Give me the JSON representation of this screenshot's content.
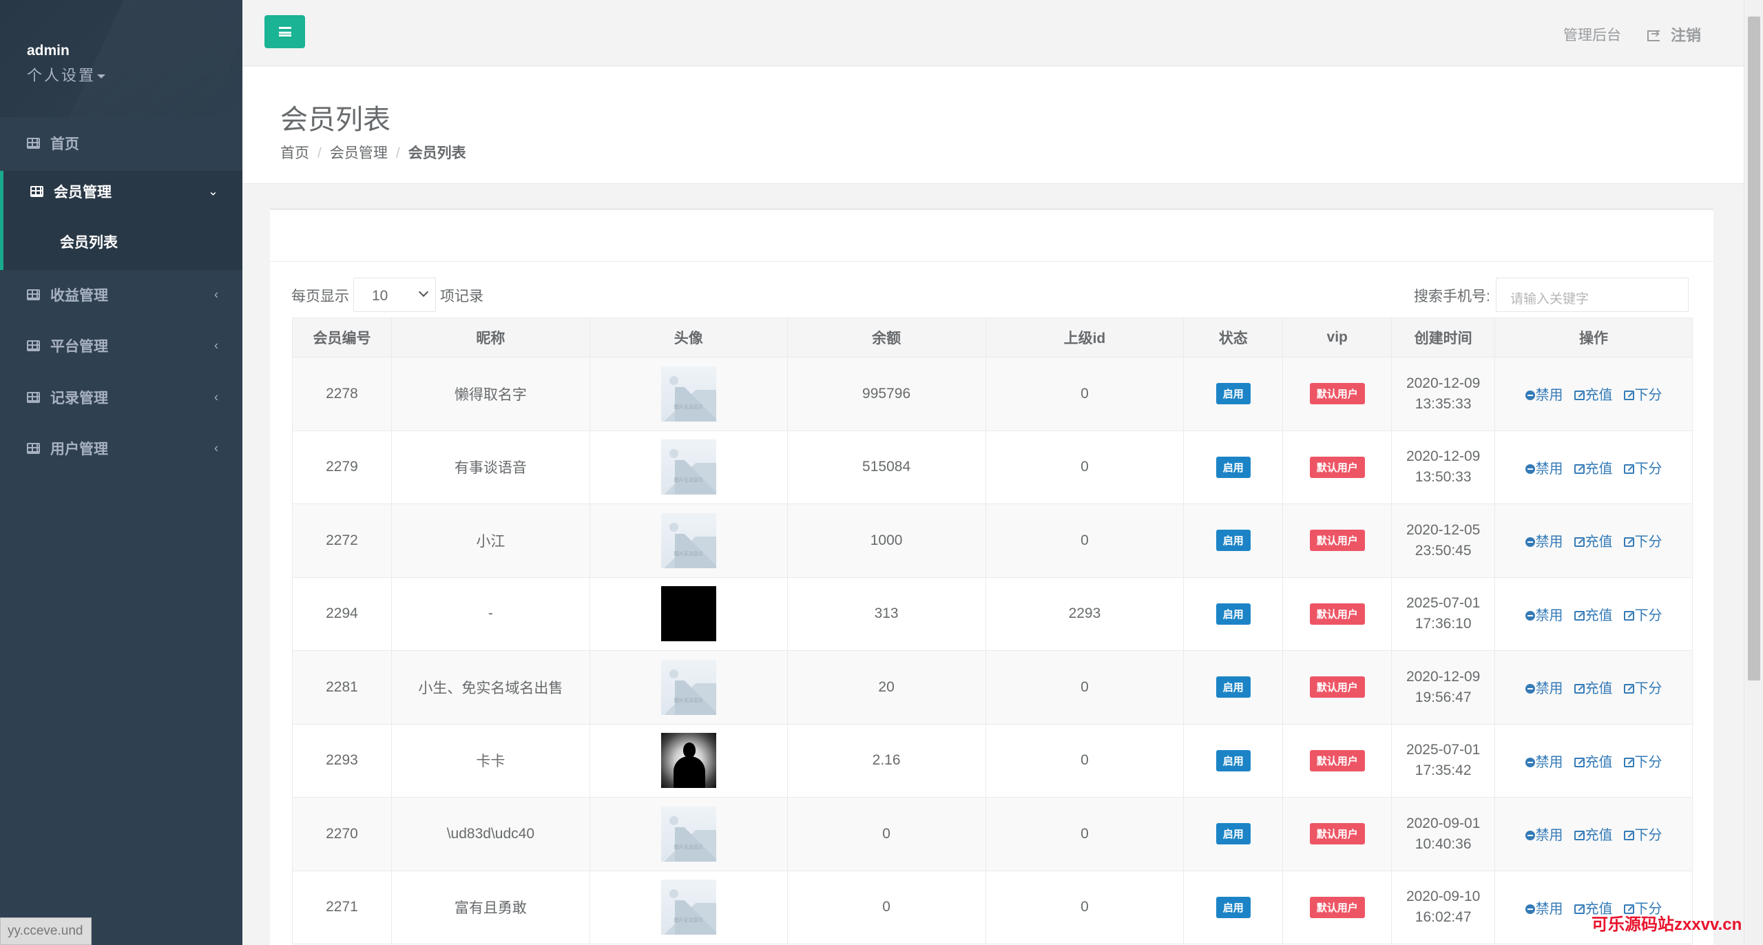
{
  "sidebar": {
    "username": "admin",
    "personal_settings": "个人设置",
    "items": [
      {
        "label": "首页"
      },
      {
        "label": "会员管理"
      },
      {
        "label": "收益管理"
      },
      {
        "label": "平台管理"
      },
      {
        "label": "记录管理"
      },
      {
        "label": "用户管理"
      }
    ],
    "sub_items": [
      {
        "label": "会员列表"
      }
    ],
    "status_url": "yy.cceve.und"
  },
  "topbar": {
    "admin_label": "管理后台",
    "logout_label": "注销"
  },
  "page": {
    "title": "会员列表",
    "breadcrumb": [
      "首页",
      "会员管理",
      "会员列表"
    ]
  },
  "table_controls": {
    "page_length_prefix": "每页显示",
    "page_length_value": "10",
    "page_length_suffix": "项记录",
    "search_label": "搜索手机号:",
    "search_placeholder": "请输入关键字"
  },
  "table": {
    "headers": [
      "会员编号",
      "昵称",
      "头像",
      "余额",
      "上级id",
      "状态",
      "vip",
      "创建时间",
      "操作"
    ],
    "placeholder_caption": "图片无法显示",
    "rows": [
      {
        "id": "2278",
        "nickname": "懒得取名字",
        "avatar": "placeholder",
        "balance": "995796",
        "parent_id": "0",
        "status": "启用",
        "vip": "默认用户",
        "date": "2020-12-09",
        "time": "13:35:33"
      },
      {
        "id": "2279",
        "nickname": "有事谈语音",
        "avatar": "placeholder",
        "balance": "515084",
        "parent_id": "0",
        "status": "启用",
        "vip": "默认用户",
        "date": "2020-12-09",
        "time": "13:50:33"
      },
      {
        "id": "2272",
        "nickname": "小江",
        "avatar": "placeholder",
        "balance": "1000",
        "parent_id": "0",
        "status": "启用",
        "vip": "默认用户",
        "date": "2020-12-05",
        "time": "23:50:45"
      },
      {
        "id": "2294",
        "nickname": "-",
        "avatar": "black",
        "balance": "313",
        "parent_id": "2293",
        "status": "启用",
        "vip": "默认用户",
        "date": "2025-07-01",
        "time": "17:36:10"
      },
      {
        "id": "2281",
        "nickname": "小生、免实名域名出售",
        "avatar": "placeholder",
        "balance": "20",
        "parent_id": "0",
        "status": "启用",
        "vip": "默认用户",
        "date": "2020-12-09",
        "time": "19:56:47"
      },
      {
        "id": "2293",
        "nickname": "卡卡",
        "avatar": "portrait",
        "balance": "2.16",
        "parent_id": "0",
        "status": "启用",
        "vip": "默认用户",
        "date": "2025-07-01",
        "time": "17:35:42"
      },
      {
        "id": "2270",
        "nickname": "\\ud83d\\udc40",
        "avatar": "placeholder",
        "balance": "0",
        "parent_id": "0",
        "status": "启用",
        "vip": "默认用户",
        "date": "2020-09-01",
        "time": "10:40:36"
      },
      {
        "id": "2271",
        "nickname": "富有且勇敢",
        "avatar": "placeholder",
        "balance": "0",
        "parent_id": "0",
        "status": "启用",
        "vip": "默认用户",
        "date": "2020-09-10",
        "time": "16:02:47"
      }
    ],
    "actions": {
      "ban": "禁用",
      "recharge": "充值",
      "deduct": "下分"
    }
  },
  "watermark": "可乐源码站zxxvv.cn",
  "colors": {
    "sidebar_bg": "#2f4050",
    "accent": "#1ab394",
    "status_badge": "#1c84c6",
    "vip_badge": "#ed5565",
    "link": "#337ab7"
  }
}
